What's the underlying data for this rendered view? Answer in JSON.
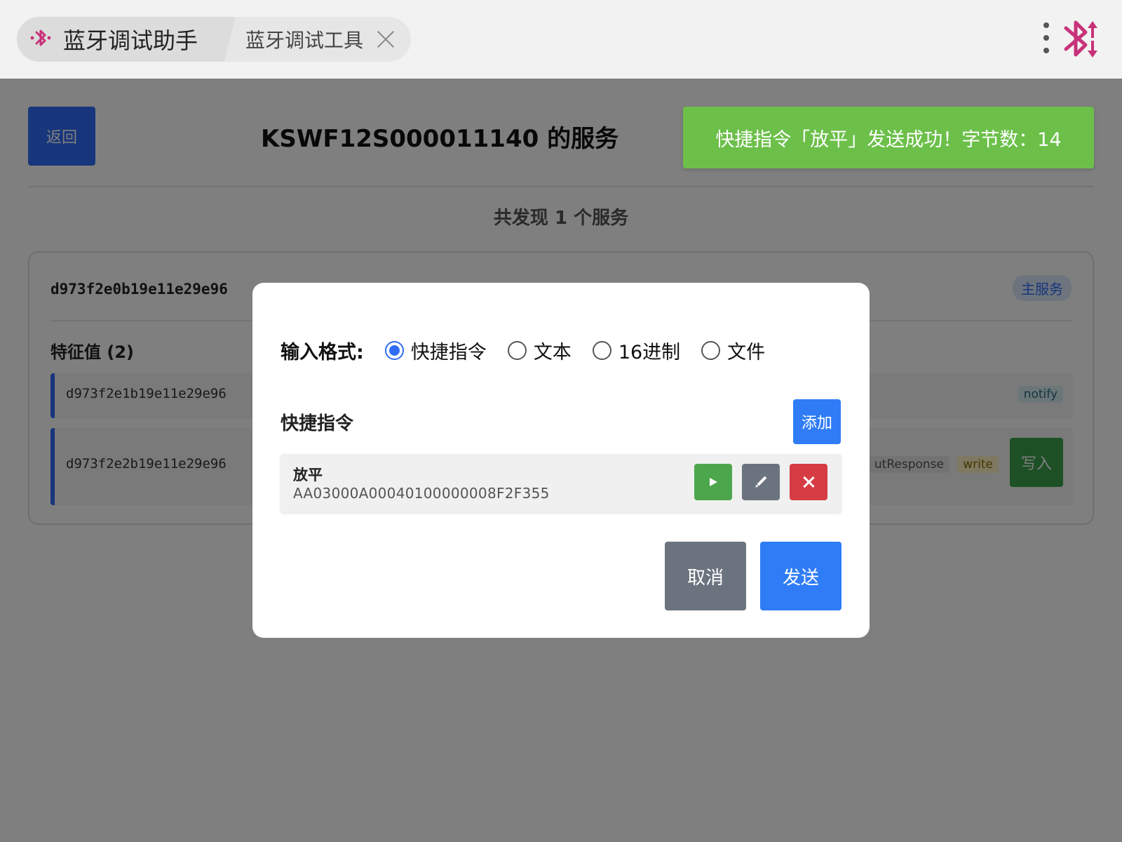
{
  "colors": {
    "accent": "#2f6df6",
    "success": "#6cc04a",
    "danger": "#d63c44",
    "secondary": "#6b747e",
    "brand_icon": "#c8327a"
  },
  "tabs": {
    "active_label": "蓝牙调试助手",
    "inactive_label": "蓝牙调试工具",
    "active_icon": "bluetooth-icon",
    "close_icon": "close-icon"
  },
  "header": {
    "menu_icon": "more-vertical-icon",
    "logo_icon": "bluetooth-transfer-icon"
  },
  "page": {
    "back_label": "返回",
    "title": "KSWF12S000011140 的服务",
    "found_count": "共发现 1 个服务",
    "service": {
      "uuid": "d973f2e0b19e11e29e96",
      "badge": "主服务",
      "characteristics_title": "特征值 (2)",
      "characteristics": [
        {
          "uuid": "d973f2e1b19e11e29e96",
          "props": [
            "notify"
          ]
        },
        {
          "uuid": "d973f2e2b19e11e29e96",
          "props": [
            "utResponse",
            "write"
          ],
          "action_label": "写入"
        }
      ]
    }
  },
  "toast": {
    "message": "快捷指令「放平」发送成功！字节数：14"
  },
  "modal": {
    "format_label": "输入格式:",
    "formats": [
      {
        "label": "快捷指令",
        "selected": true
      },
      {
        "label": "文本",
        "selected": false
      },
      {
        "label": "16进制",
        "selected": false
      },
      {
        "label": "文件",
        "selected": false
      }
    ],
    "quick_title": "快捷指令",
    "add_label": "添加",
    "commands": [
      {
        "name": "放平",
        "hex": "AA03000A00040100000008F2F355"
      }
    ],
    "cancel_label": "取消",
    "send_label": "发送"
  }
}
